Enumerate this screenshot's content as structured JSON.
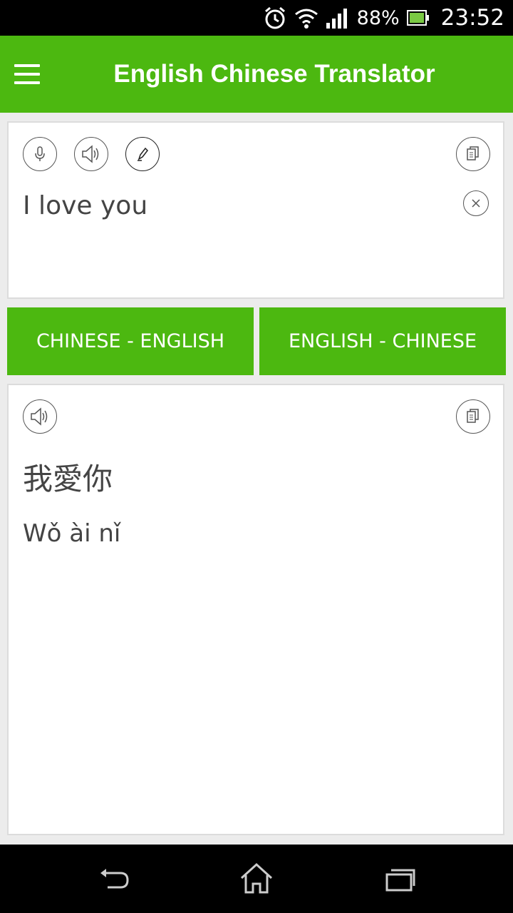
{
  "status_bar": {
    "battery_percent": "88%",
    "time": "23:52",
    "icons": [
      "alarm-icon",
      "wifi-icon",
      "signal-icon",
      "battery-icon"
    ]
  },
  "app_bar": {
    "title": "English Chinese Translator",
    "menu_icon": "menu-icon"
  },
  "input": {
    "text": "I love you",
    "icons": [
      "microphone-icon",
      "speaker-icon",
      "pencil-icon",
      "copy-icon",
      "clear-icon"
    ]
  },
  "lang_buttons": {
    "left_label": "CHINESE - ENGLISH",
    "right_label": "ENGLISH - CHINESE"
  },
  "output": {
    "chinese": "我愛你",
    "pinyin": "Wǒ ài nǐ",
    "icons": [
      "speaker-icon",
      "copy-icon"
    ]
  },
  "nav_bar": {
    "icons": [
      "back-icon",
      "home-icon",
      "recent-apps-icon"
    ]
  },
  "colors": {
    "accent": "#4cb810",
    "status_bar": "#000000",
    "background": "#ececec",
    "text": "#444444"
  }
}
